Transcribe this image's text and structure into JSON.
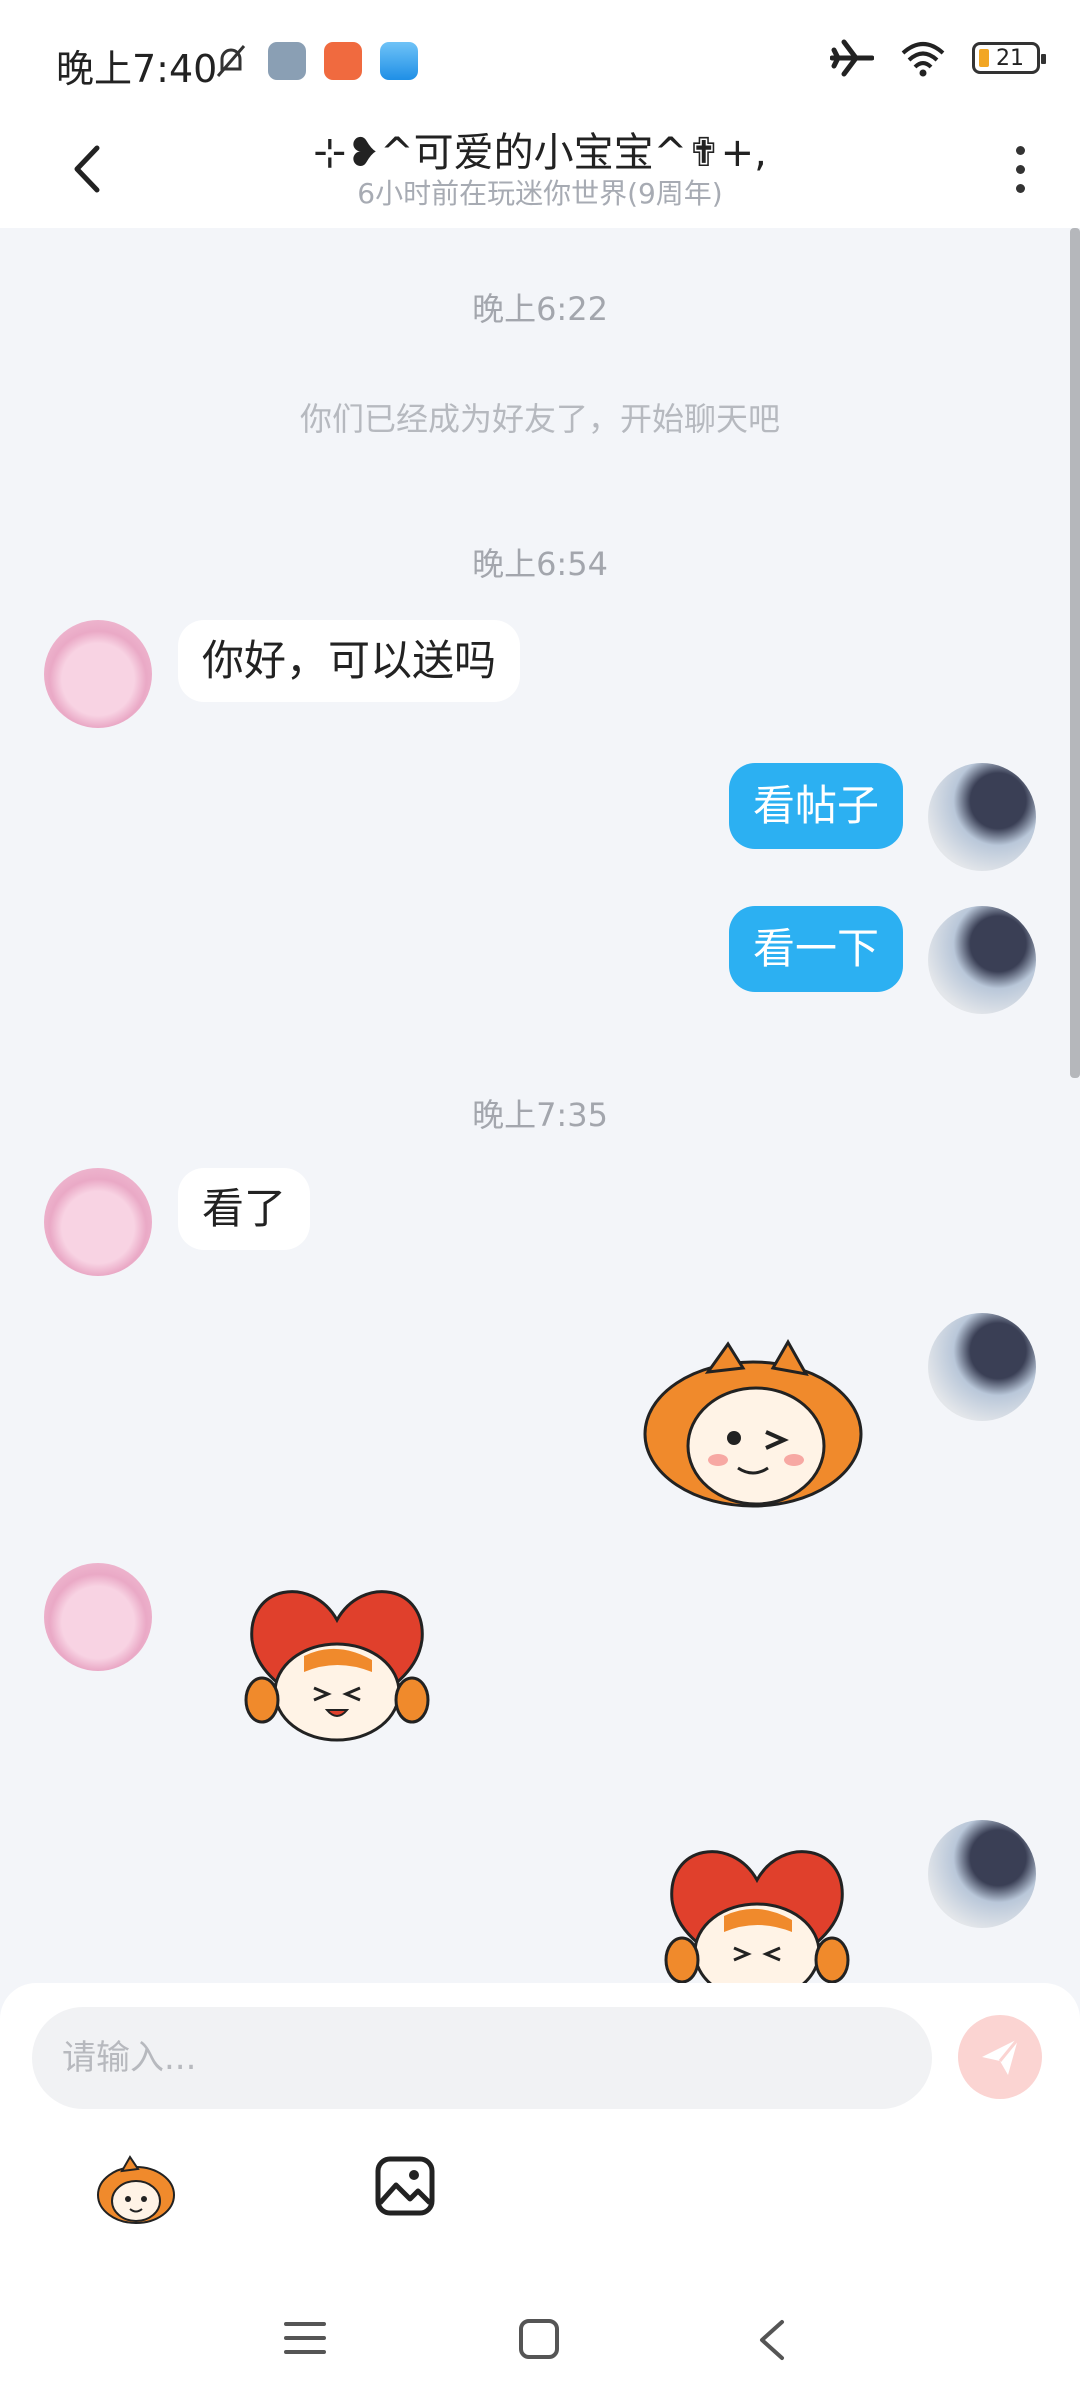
{
  "status_bar": {
    "time": "晚上7:40",
    "battery": "21",
    "icons": [
      "mute-bell-icon",
      "app-icon-steering",
      "app-icon-orange",
      "app-icon-blue",
      "airplane-icon",
      "wifi-icon",
      "battery-icon"
    ]
  },
  "header": {
    "title": "⊹❥^可爱的小宝宝^✟+,",
    "subtitle": "6小时前在玩迷你世界(9周年)"
  },
  "messages": [
    {
      "type": "timestamp",
      "text": "晚上6:22"
    },
    {
      "type": "system",
      "text": "你们已经成为好友了，开始聊天吧"
    },
    {
      "type": "timestamp",
      "text": "晚上6:54"
    },
    {
      "type": "incoming",
      "text": "你好，可以送吗"
    },
    {
      "type": "outgoing",
      "text": "看帖子"
    },
    {
      "type": "outgoing",
      "text": "看一下"
    },
    {
      "type": "timestamp",
      "text": "晚上7:35"
    },
    {
      "type": "incoming",
      "text": "看了"
    },
    {
      "type": "outgoing_sticker",
      "sticker": "wink-mascot-sticker"
    },
    {
      "type": "incoming_sticker",
      "sticker": "heart-mascot-sticker"
    },
    {
      "type": "outgoing_sticker",
      "sticker": "heart-mascot-sticker"
    }
  ],
  "composer": {
    "placeholder": "请输入...",
    "tools": [
      "emoji-sticker-icon",
      "image-icon"
    ]
  },
  "colors": {
    "outgoing_bubble": "#2cb0f2",
    "send_button": "#fbd4d2",
    "chat_background": "#f3f5f9"
  }
}
